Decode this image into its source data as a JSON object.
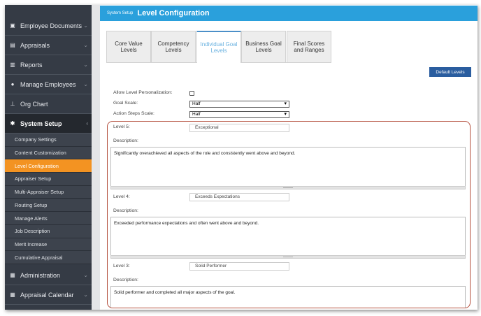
{
  "sidebar": {
    "items": [
      {
        "label": "Employee Documents",
        "icon": "id-card-icon"
      },
      {
        "label": "Appraisals",
        "icon": "appraisal-icon"
      },
      {
        "label": "Reports",
        "icon": "report-icon"
      },
      {
        "label": "Manage Employees",
        "icon": "users-icon"
      },
      {
        "label": "Org Chart",
        "icon": "org-chart-icon"
      },
      {
        "label": "System Setup",
        "icon": "gear-icon"
      }
    ],
    "sub_items": [
      "Company Settings",
      "Content Customization",
      "Level Configuration",
      "Appraiser Setup",
      "Multi-Appraiser Setup",
      "Routing Setup",
      "Manage Alerts",
      "Job Description",
      "Merit Increase",
      "Cumulative Appraisal"
    ],
    "bottom_items": [
      {
        "label": "Administration",
        "icon": "building-icon"
      },
      {
        "label": "Appraisal Calendar",
        "icon": "calendar-icon"
      }
    ]
  },
  "header": {
    "breadcrumb": "System Setup",
    "title": "Level Configuration"
  },
  "tabs": [
    "Core Value Levels",
    "Competency Levels",
    "Individual Goal Levels",
    "Business Goal Levels",
    "Final Scores and Ranges"
  ],
  "default_levels_button": "Default Levels",
  "form": {
    "allow_label": "Allow Level Personalization:",
    "allow_checked": false,
    "goal_scale_label": "Goal Scale:",
    "goal_scale_value": "Half",
    "action_scale_label": "Action Steps Scale:",
    "action_scale_value": "Half"
  },
  "levels": [
    {
      "label": "Level 5:",
      "name": "Exceptional",
      "desc_label": "Description:",
      "description": "Significantly overachieved all aspects of the role and consistently went above and beyond."
    },
    {
      "label": "Level 4:",
      "name": "Exceeds Expectations",
      "desc_label": "Description:",
      "description": "Exceeded performance expectations and often went above and beyond."
    },
    {
      "label": "Level 3:",
      "name": "Solid Performer",
      "desc_label": "Description:",
      "description": "Solid performer and completed all major aspects of the goal."
    }
  ],
  "colors": {
    "sidebar": "#353b45",
    "active": "#f39322",
    "header": "#2aa0dc",
    "button": "#2a5d9f",
    "highlight": "#b5513f"
  }
}
